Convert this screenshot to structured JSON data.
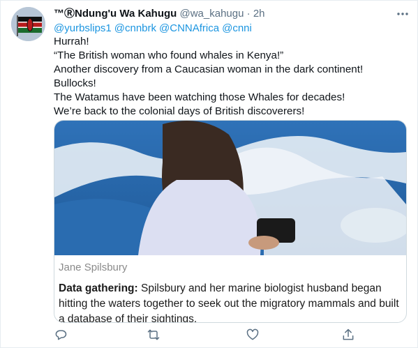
{
  "tweet": {
    "display_name": "™ⓇNdung'u Wa Kahugu",
    "handle": "@wa_kahugu",
    "separator": "·",
    "time": "2h",
    "mentions": [
      "@yurbslips1",
      "@cnnbrk",
      "@CNNAfrica",
      "@cnni"
    ],
    "lines": [
      "Hurrah!",
      "“The British woman who found whales in Kenya!”",
      "Another discovery from a Caucasian woman in the dark continent!",
      "Bullocks!",
      "The Watamus have been watching those Whales for decades!",
      "We’re back to the colonial days of British discoverers!"
    ]
  },
  "card": {
    "caption": "Jane Spilsbury",
    "lead": "Data gathering:",
    "text": " Spilsbury and her marine biologist husband began hitting the waters together to seek out the migratory mammals and built a database of their sightings."
  },
  "icons": {
    "more": "more-horizontal-icon",
    "reply": "reply-icon",
    "retweet": "retweet-icon",
    "like": "like-icon",
    "share": "share-icon"
  },
  "colors": {
    "link": "#1b95e0",
    "secondary": "#5b7083",
    "border": "#cfd9de"
  }
}
